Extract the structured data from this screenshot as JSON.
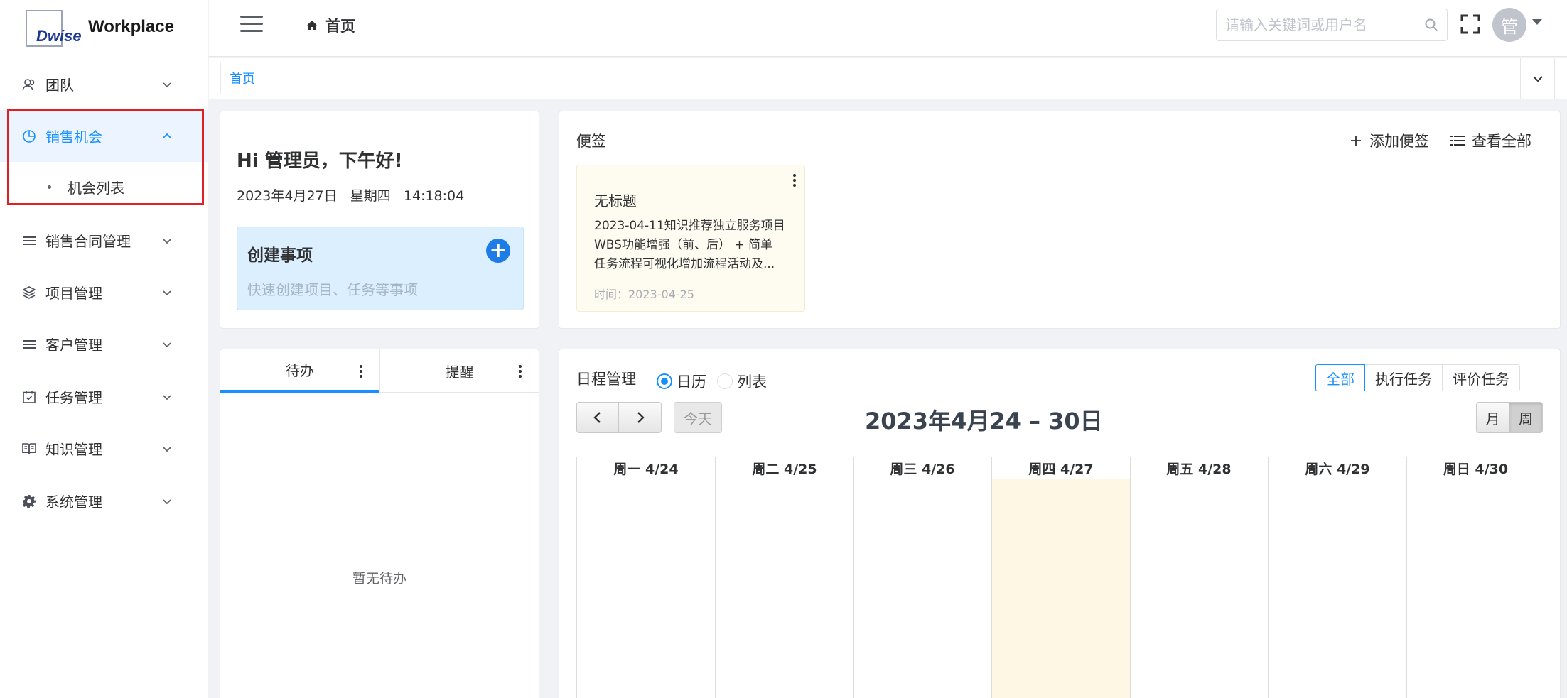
{
  "brand": {
    "logo_text": "Dwise",
    "name": "Workplace"
  },
  "sidebar": {
    "items": [
      {
        "label": "团队",
        "icon": "team-icon"
      },
      {
        "label": "销售机会",
        "icon": "pie-chart-icon",
        "active": true,
        "expanded": true,
        "children": [
          {
            "label": "机会列表"
          }
        ]
      },
      {
        "label": "销售合同管理",
        "icon": "list-icon"
      },
      {
        "label": "项目管理",
        "icon": "layers-icon"
      },
      {
        "label": "客户管理",
        "icon": "list-icon"
      },
      {
        "label": "任务管理",
        "icon": "calendar-check-icon"
      },
      {
        "label": "知识管理",
        "icon": "book-icon"
      },
      {
        "label": "系统管理",
        "icon": "gear-icon"
      }
    ]
  },
  "header": {
    "breadcrumb": "首页",
    "search_placeholder": "请输入关键词或用户名",
    "avatar_text": "管"
  },
  "tagbar": {
    "tags": [
      "首页"
    ]
  },
  "greeting": {
    "title": "Hi 管理员，下午好!",
    "date": "2023年4月27日",
    "weekday": "星期四",
    "time": "14:18:04",
    "create_title": "创建事项",
    "create_subtitle": "快速创建项目、任务等事项"
  },
  "notes": {
    "title": "便签",
    "add_label": "添加便签",
    "view_all_label": "查看全部",
    "items": [
      {
        "title": "无标题",
        "body_lines": [
          "2023-04-11知识推荐独立服务项目",
          "WBS功能增强（前、后） + 简单",
          "任务流程可视化增加流程活动及..."
        ],
        "time": "时间：2023-04-25"
      }
    ]
  },
  "todo": {
    "tabs": [
      "待办",
      "提醒"
    ],
    "active_tab": 0,
    "empty_text": "暂无待办"
  },
  "schedule": {
    "title": "日程管理",
    "view_modes": [
      "日历",
      "列表"
    ],
    "selected_view_mode": "日历",
    "filters": [
      "全部",
      "执行任务",
      "评价任务"
    ],
    "selected_filter": "全部",
    "today_label": "今天",
    "range_title": "2023年4月24 – 30日",
    "period_buttons": [
      "月",
      "周"
    ],
    "selected_period": "周",
    "days": [
      "周一 4/24",
      "周二 4/25",
      "周三 4/26",
      "周四 4/27",
      "周五 4/28",
      "周六 4/29",
      "周日 4/30"
    ],
    "today_index": 3
  },
  "colors": {
    "accent": "#1890ff",
    "highlight_border": "#e02020",
    "today_bg": "#fdf7e3",
    "note_bg": "#fefbf0"
  }
}
